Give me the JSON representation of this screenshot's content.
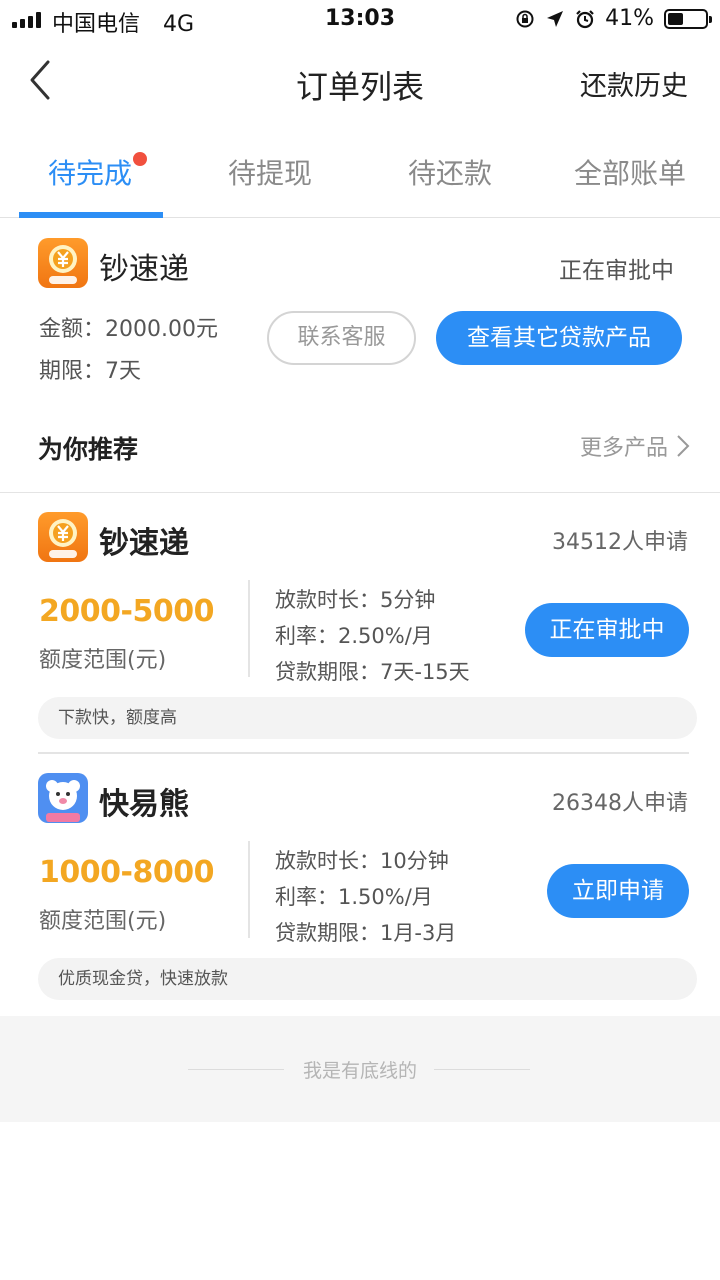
{
  "status_bar": {
    "carrier": "中国电信",
    "network": "4G",
    "time": "13:03",
    "battery": "41%",
    "battery_level": 0.41
  },
  "nav": {
    "title": "订单列表",
    "right_link": "还款历史"
  },
  "tabs": [
    {
      "label": "待完成",
      "active": true,
      "has_dot": true
    },
    {
      "label": "待提现",
      "active": false
    },
    {
      "label": "待还款",
      "active": false
    },
    {
      "label": "全部账单",
      "active": false
    }
  ],
  "order": {
    "app_name": "钞速递",
    "status": "正在审批中",
    "amount_label": "金额：2000.00元",
    "term_label": "期限：7天",
    "contact_button": "联系客服",
    "other_products_button": "查看其它贷款产品"
  },
  "recommend": {
    "title": "为你推荐",
    "more_link": "更多产品",
    "items": [
      {
        "name": "钞速递",
        "apply_count": "34512人申请",
        "range": "2000-5000",
        "range_label": "额度范围(元)",
        "loan_time": "放款时长：5分钟",
        "rate": "利率：2.50%/月",
        "term": "贷款期限：7天-15天",
        "button": "正在审批中",
        "tag": "下款快，额度高"
      },
      {
        "name": "快易熊",
        "apply_count": "26348人申请",
        "range": "1000-8000",
        "range_label": "额度范围(元)",
        "loan_time": "放款时长：10分钟",
        "rate": "利率：1.50%/月",
        "term": "贷款期限：1月-3月",
        "button": "立即申请",
        "tag": "优质现金贷，快速放款"
      }
    ]
  },
  "footer": {
    "text": "我是有底线的"
  },
  "colors": {
    "accent": "#2c8ef5",
    "range": "#f3a722",
    "dot": "#f1503e",
    "logo_orange": "#f07512",
    "logo_blue": "#4f8ff1"
  },
  "icons": {
    "back": "chevron-left-icon",
    "more": "chevron-right-icon",
    "logo1": "yuan-coin-icon",
    "logo2": "bear-icon"
  }
}
